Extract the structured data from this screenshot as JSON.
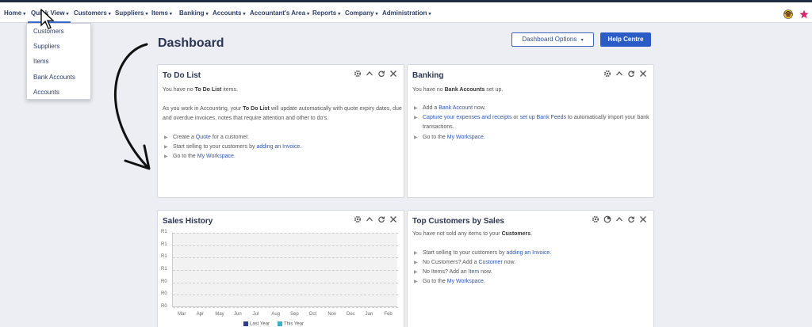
{
  "nav": {
    "items": [
      {
        "label": "Home"
      },
      {
        "label": "Quick View"
      },
      {
        "label": "Customers"
      },
      {
        "label": "Suppliers"
      },
      {
        "label": "Items"
      },
      {
        "label": "Banking"
      },
      {
        "label": "Accounts"
      },
      {
        "label": "Accountant's Area"
      },
      {
        "label": "Reports"
      },
      {
        "label": "Company"
      },
      {
        "label": "Administration"
      }
    ],
    "caret": "▾",
    "icons": [
      "support-agent-icon",
      "star-icon"
    ],
    "star_color": "#d6266d"
  },
  "quick_view_menu": [
    "Customers",
    "Suppliers",
    "Items",
    "Bank Accounts",
    "Accounts"
  ],
  "header": {
    "title": "Dashboard",
    "options_label": "Dashboard Options",
    "options_caret": "▾",
    "help_label": "Help Centre"
  },
  "todo": {
    "title": "To Do List",
    "line1_pre": "You have no ",
    "line1_bold": "To Do List",
    "line1_post": " items.",
    "para_pre": "As you work in Accounting, your ",
    "para_bold": "To Do List",
    "para_post": " will update automatically with quote expiry dates, due",
    "para_line2": "and overdue invoices, notes that require attention and other to do's.",
    "b1_pre": "Create a ",
    "b1_link": "Quote",
    "b1_post": " for a customer.",
    "b2_pre": "Start selling to your customers by ",
    "b2_link": "adding an Invoice.",
    "b3_pre": "Go to the ",
    "b3_link": "My Workspace."
  },
  "banking": {
    "title": "Banking",
    "line1_pre": "You have no ",
    "line1_bold": "Bank Accounts",
    "line1_post": " set up.",
    "b1_pre": "Add a ",
    "b1_link": "Bank Account",
    "b1_post": " now.",
    "b2_link1": "Capture your expenses and receipts",
    "b2_mid": " or ",
    "b2_link2": "set up Bank Feeds",
    "b2_post": " to automatically import your bank",
    "b2_line2": "transactions.",
    "b3_pre": "Go to the ",
    "b3_link": "My Workspace."
  },
  "sales_history": {
    "title": "Sales History",
    "legend": [
      "Last Year",
      "This Year"
    ]
  },
  "top_customers": {
    "title": "Top Customers by Sales",
    "line1_pre": "You have not sold any items to your ",
    "line1_bold": "Customers",
    "line1_post": ".",
    "b1_pre": "Start selling to your customers by ",
    "b1_link": "adding an Invoice.",
    "b2_pre": "No Customers? Add a ",
    "b2_link": "Customer",
    "b2_post": " now.",
    "b3_pre": "No Items? Add an ",
    "b3_link": "Item",
    "b3_post": " now.",
    "b4_pre": "Go to the ",
    "b4_link": "My Workspace."
  },
  "bullet_glyph": "▶",
  "chart_data": {
    "type": "line",
    "categories": [
      "Mar",
      "Apr",
      "May",
      "Jun",
      "Jul",
      "Aug",
      "Sep",
      "Oct",
      "Nov",
      "Dec",
      "Jan",
      "Feb"
    ],
    "y_tick_labels": [
      "R1",
      "R1",
      "R1",
      "R1",
      "R0",
      "R0",
      "R0"
    ],
    "series": [
      {
        "name": "Last Year",
        "values": [
          0,
          0,
          0,
          0,
          0,
          0,
          0,
          0,
          0,
          0,
          0,
          0
        ],
        "color": "#2a3f8f"
      },
      {
        "name": "This Year",
        "values": [
          0,
          0,
          0,
          0,
          0,
          0,
          0,
          0,
          0,
          0,
          0,
          0
        ],
        "color": "#3bb0c9"
      }
    ],
    "grid": true,
    "legend_position": "bottom"
  }
}
